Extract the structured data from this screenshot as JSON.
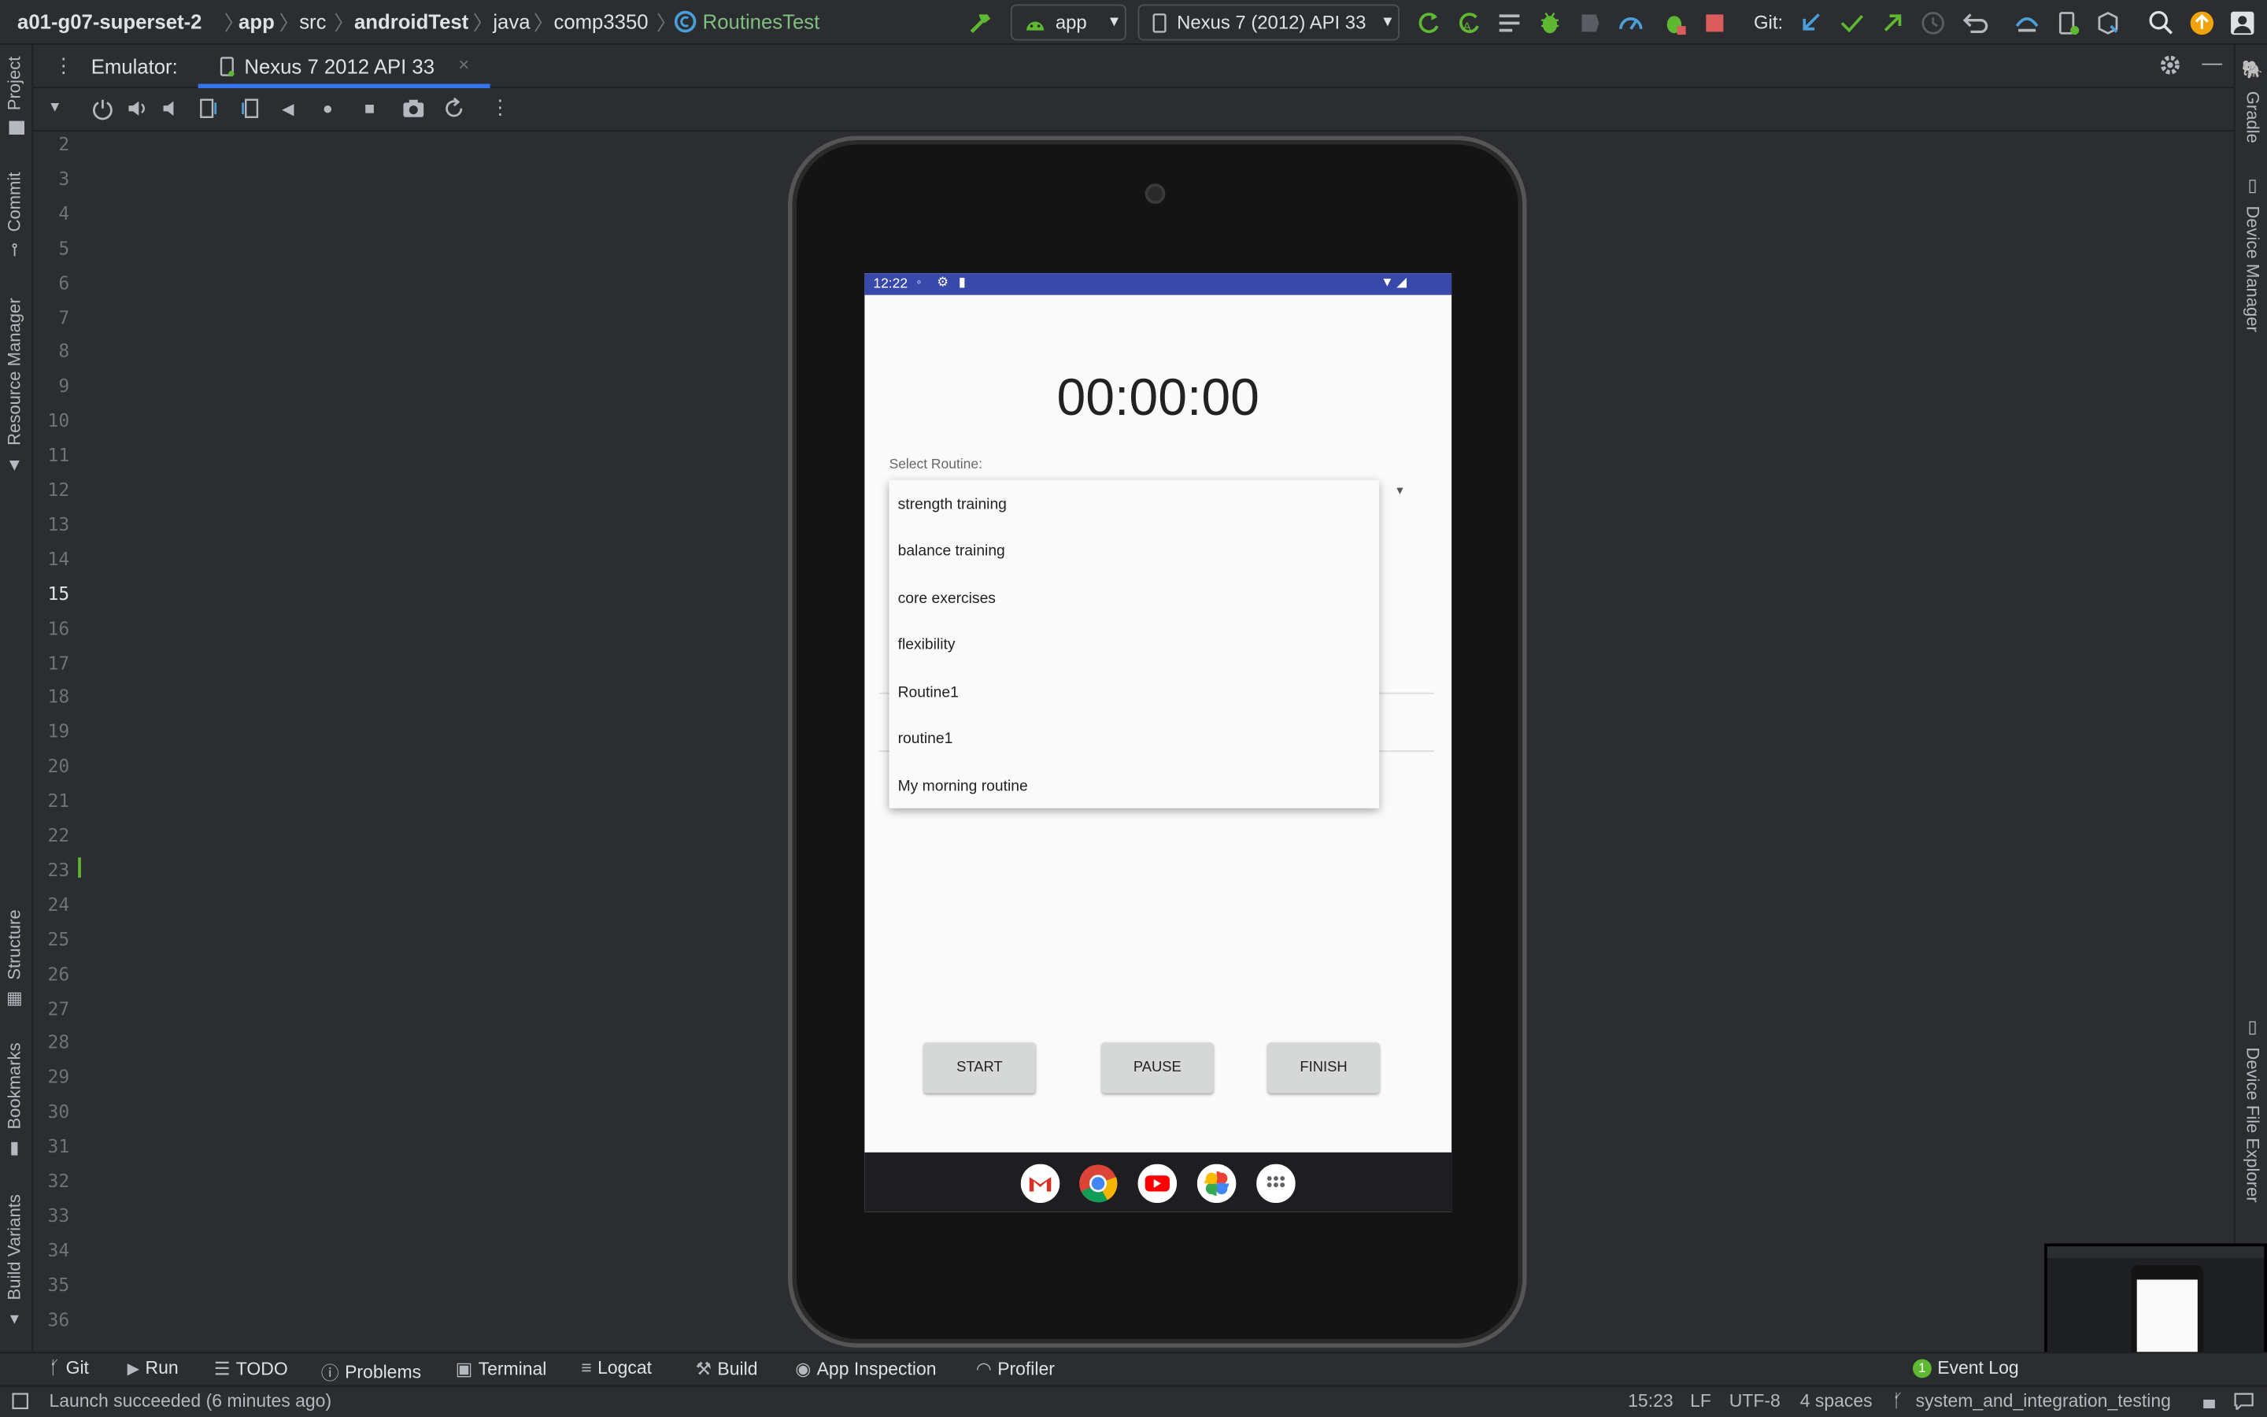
{
  "toolbar": {
    "breadcrumbs": [
      "a01-g07-superset-2",
      "app",
      "src",
      "androidTest",
      "java",
      "comp3350",
      "RoutinesTest"
    ],
    "run_config": "app",
    "device": "Nexus 7 (2012) API 33",
    "git_label": "Git:"
  },
  "emulator": {
    "label": "Emulator:",
    "tab": "Nexus 7 2012 API 33"
  },
  "left_tabs": [
    "Project",
    "Commit",
    "Resource Manager",
    "Structure",
    "Bookmarks",
    "Build Variants"
  ],
  "right_tabs": [
    "Gradle",
    "Device Manager",
    "Device File Explorer"
  ],
  "gutter": {
    "lines": [
      "2",
      "3",
      "4",
      "5",
      "6",
      "7",
      "8",
      "9",
      "10",
      "11",
      "12",
      "13",
      "14",
      "15",
      "16",
      "17",
      "18",
      "19",
      "20",
      "21",
      "22",
      "23",
      "24",
      "25",
      "26",
      "27",
      "28",
      "29",
      "30",
      "31",
      "32",
      "33",
      "34",
      "35",
      "36"
    ]
  },
  "phone": {
    "status_time": "12:22",
    "timer": "00:00:00",
    "select_label": "Select Routine:",
    "routines": [
      "strength training",
      "balance training",
      "core exercises",
      "flexibility",
      "Routine1",
      "routine1",
      "My morning routine"
    ],
    "buttons": {
      "start": "START",
      "pause": "PAUSE",
      "finish": "FINISH"
    },
    "dock": [
      "gmail-icon",
      "chrome-icon",
      "youtube-icon",
      "photos-icon",
      "apps-icon"
    ]
  },
  "tool_windows": {
    "git": "Git",
    "run": "Run",
    "todo": "TODO",
    "problems": "Problems",
    "terminal": "Terminal",
    "logcat": "Logcat",
    "build": "Build",
    "app_inspection": "App Inspection",
    "profiler": "Profiler",
    "event_log": "Event Log",
    "event_count": "1"
  },
  "status": {
    "message": "Launch succeeded (6 minutes ago)",
    "position": "15:23",
    "line_sep": "LF",
    "encoding": "UTF-8",
    "indent": "4 spaces",
    "branch": "system_and_integration_testing"
  },
  "colors": {
    "accent": "#3574f0",
    "android_status": "#3949ab",
    "green": "#5fb832",
    "red": "#db5c5c"
  }
}
